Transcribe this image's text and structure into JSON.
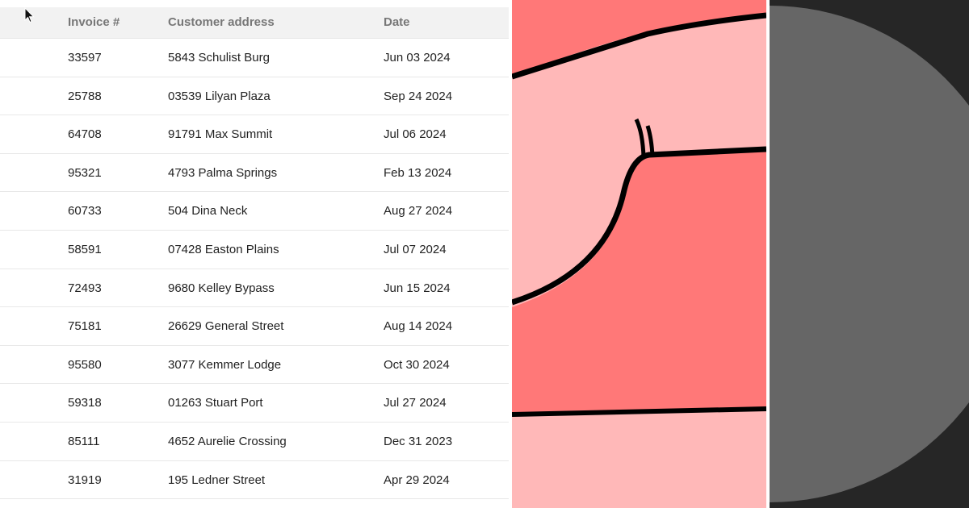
{
  "table": {
    "headers": {
      "invoice": "Invoice #",
      "address": "Customer address",
      "date": "Date"
    },
    "rows": [
      {
        "invoice": "33597",
        "address": "5843 Schulist Burg",
        "date": "Jun 03 2024"
      },
      {
        "invoice": "25788",
        "address": "03539 Lilyan Plaza",
        "date": "Sep 24 2024"
      },
      {
        "invoice": "64708",
        "address": "91791 Max Summit",
        "date": "Jul 06 2024"
      },
      {
        "invoice": "95321",
        "address": "4793 Palma Springs",
        "date": "Feb 13 2024"
      },
      {
        "invoice": "60733",
        "address": "504 Dina Neck",
        "date": "Aug 27 2024"
      },
      {
        "invoice": "58591",
        "address": "07428 Easton Plains",
        "date": "Jul 07 2024"
      },
      {
        "invoice": "72493",
        "address": "9680 Kelley Bypass",
        "date": "Jun 15 2024"
      },
      {
        "invoice": "75181",
        "address": "26629 General Street",
        "date": "Aug 14 2024"
      },
      {
        "invoice": "95580",
        "address": "3077 Kemmer Lodge",
        "date": "Oct 30 2024"
      },
      {
        "invoice": "59318",
        "address": "01263 Stuart Port",
        "date": "Jul 27 2024"
      },
      {
        "invoice": "85111",
        "address": "4652 Aurelie Crossing",
        "date": "Dec 31 2023"
      },
      {
        "invoice": "31919",
        "address": "195 Ledner Street",
        "date": "Apr 29 2024"
      }
    ]
  },
  "colors": {
    "header_bg": "#f2f2f2",
    "header_text": "#777777",
    "cell_text": "#222222",
    "art_light_pink": "#ffb8b8",
    "art_salmon": "#ff7878",
    "dark_bg": "#262626",
    "circle_gray": "#666666"
  },
  "icons": {
    "cursor": "mouse-pointer-icon"
  }
}
